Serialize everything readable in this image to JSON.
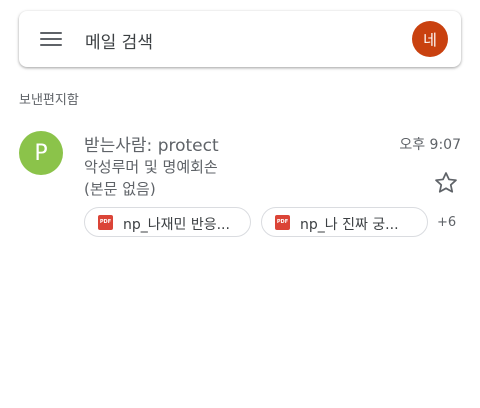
{
  "search": {
    "placeholder": "메일 검색",
    "account_initial": "네",
    "account_color": "#c9410f"
  },
  "folder": {
    "title": "보낸편지함"
  },
  "emails": [
    {
      "avatar_letter": "P",
      "avatar_color": "#8bc34a",
      "sender": "받는사람: protect",
      "time": "오후 9:07",
      "subject": "악성루머 및 명예회손",
      "snippet": "(본문 없음)",
      "starred": false,
      "attachments": [
        {
          "icon": "pdf-icon",
          "icon_text": "PDF",
          "name": "np_나재민 반응..."
        },
        {
          "icon": "pdf-icon",
          "icon_text": "PDF",
          "name": "np_나 진짜 궁..."
        }
      ],
      "more_attachments": "+6"
    }
  ]
}
